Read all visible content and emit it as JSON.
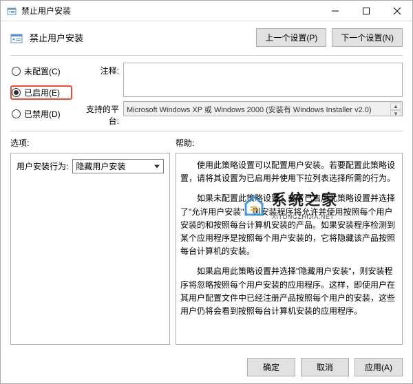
{
  "window": {
    "title": "禁止用户安装"
  },
  "header": {
    "title": "禁止用户安装",
    "prev_btn": "上一个设置(P)",
    "next_btn": "下一个设置(N)"
  },
  "radios": {
    "not_configured": "未配置(C)",
    "enabled": "已启用(E)",
    "disabled": "已禁用(D)"
  },
  "fields": {
    "comment_label": "注释:",
    "comment_value": "",
    "platform_label": "支持的平台:",
    "platform_value": "Microsoft Windows XP 或 Windows 2000 (安装有 Windows Installer v2.0)"
  },
  "section": {
    "options_label": "选项:",
    "help_label": "帮助:"
  },
  "options": {
    "behavior_label": "用户安装行为:",
    "behavior_value": "隐藏用户安装"
  },
  "help": {
    "p1": "使用此策略设置可以配置用户安装。若要配置此策略设置，请将其设置为已启用并使用下拉列表选择所需的行为。",
    "p2": "如果未配置此策略设置，或者已启用此策略设置并选择了\"允许用户安装\"，则安装程序将允许并使用按照每个用户安装的和按照每台计算机安装的产品。如果安装程序检测到某个应用程序是按照每个用户安装的，它将隐藏该产品按照每台计算机的安装。",
    "p3": "如果启用此策略设置并选择\"隐藏用户安装\"，则安装程序将忽略按照每个用户安装的应用程序。这样，即使用户在其用户配置文件中已经注册产品按照每个用户的安装，这些用户仍将会看到按照每台计算机安装的应用程序。"
  },
  "footer": {
    "ok": "确定",
    "cancel": "取消",
    "apply": "应用(A)"
  },
  "watermark": {
    "main": "系统之家",
    "sub": "XITONGZHIJIA.NET"
  }
}
